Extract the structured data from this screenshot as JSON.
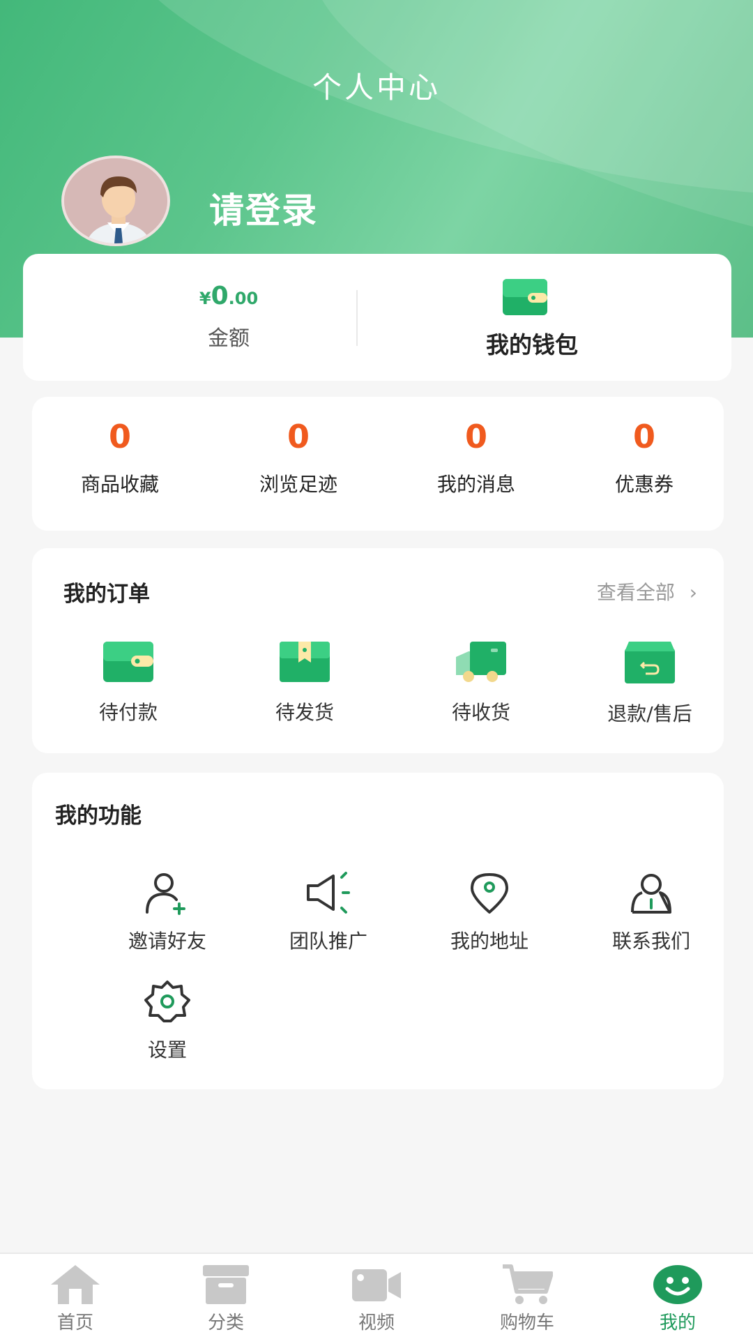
{
  "header": {
    "title": "个人中心"
  },
  "user": {
    "login_text": "请登录"
  },
  "wallet": {
    "amount_symbol": "¥",
    "amount_int": "0",
    "amount_dec": ".00",
    "amount_label": "金额",
    "wallet_label": "我的钱包"
  },
  "stats": [
    {
      "value": "0",
      "label": "商品收藏"
    },
    {
      "value": "0",
      "label": "浏览足迹"
    },
    {
      "value": "0",
      "label": "我的消息"
    },
    {
      "value": "0",
      "label": "优惠券"
    }
  ],
  "orders": {
    "title": "我的订单",
    "view_all": "查看全部",
    "items": [
      {
        "label": "待付款",
        "icon": "wallet-icon"
      },
      {
        "label": "待发货",
        "icon": "package-icon"
      },
      {
        "label": "待收货",
        "icon": "truck-icon"
      },
      {
        "label": "退款/售后",
        "icon": "refund-box-icon"
      }
    ]
  },
  "functions": {
    "title": "我的功能",
    "items": [
      {
        "label": "邀请好友",
        "icon": "add-user-icon"
      },
      {
        "label": "团队推广",
        "icon": "megaphone-icon"
      },
      {
        "label": "我的地址",
        "icon": "location-pin-icon"
      },
      {
        "label": "联系我们",
        "icon": "contact-person-icon"
      },
      {
        "label": "设置",
        "icon": "gear-icon"
      }
    ]
  },
  "tabbar": [
    {
      "label": "首页",
      "icon": "home-icon"
    },
    {
      "label": "分类",
      "icon": "category-box-icon"
    },
    {
      "label": "视频",
      "icon": "video-camera-icon"
    },
    {
      "label": "购物车",
      "icon": "cart-icon"
    },
    {
      "label": "我的",
      "icon": "smiley-icon",
      "active": true
    }
  ],
  "colors": {
    "brand_green": "#2fa86a",
    "count_orange": "#f05a1e",
    "tab_active": "#1f9a5b"
  }
}
